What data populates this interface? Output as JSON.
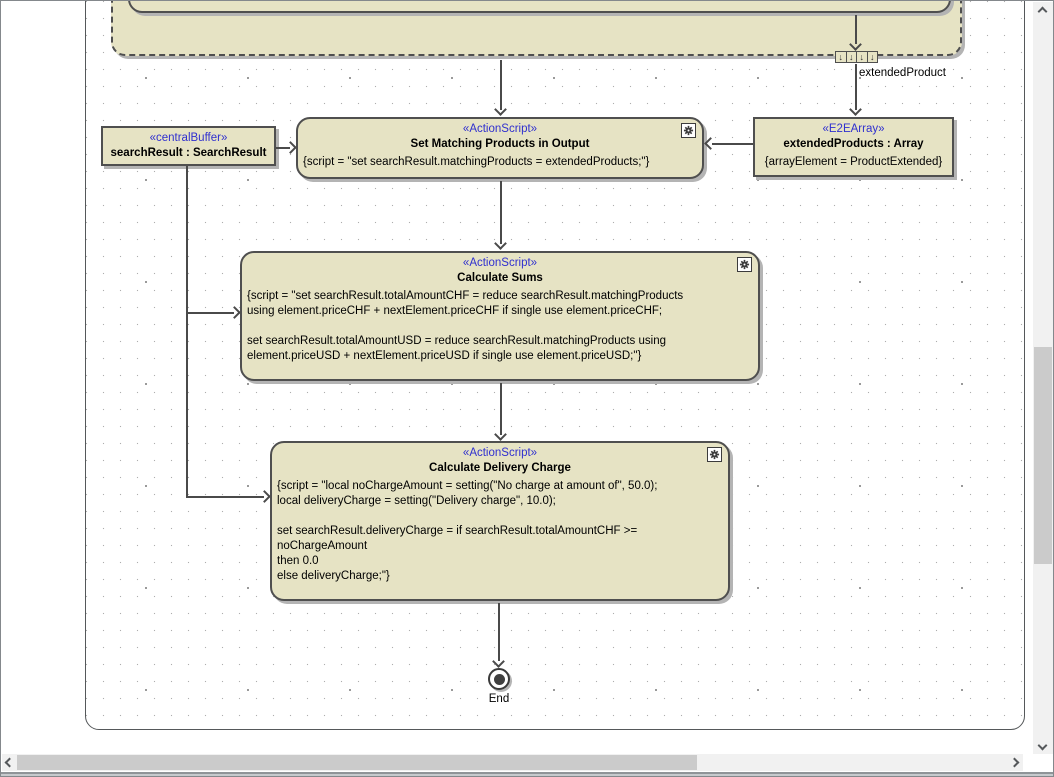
{
  "colors": {
    "node_fill": "#e6e3c4",
    "node_border": "#4f4f4f",
    "stereotype": "#3030cf",
    "edge": "#4a4a4a",
    "shadow": "#b4b4b4",
    "grid_dot": "#aeaeae",
    "grid_cross": "#9a9a9a",
    "scrollbar_track": "#f1f1f1",
    "scrollbar_thumb": "#cbcbcb",
    "scrollbar_arrow": "#55585b"
  },
  "canvas": {
    "expansion_node_label": "extendedProduct",
    "expansion_arrow_glyph": "↓",
    "end_label": "End"
  },
  "nodes": {
    "central_buffer": {
      "stereotype": "«centralBuffer»",
      "name": "searchResult : SearchResult"
    },
    "set_matching_products": {
      "stereotype": "«ActionScript»",
      "name": "Set Matching Products in Output",
      "script": "{script = \"set searchResult.matchingProducts = extendedProducts;\"}"
    },
    "extended_products": {
      "stereotype": "«E2EArray»",
      "name": "extendedProducts : Array",
      "constraint": "{arrayElement = ProductExtended}"
    },
    "calculate_sums": {
      "stereotype": "«ActionScript»",
      "name": "Calculate Sums",
      "script": "{script = \"set searchResult.totalAmountCHF = reduce searchResult.matchingProducts\nusing element.priceCHF + nextElement.priceCHF if single use element.priceCHF;\n\nset searchResult.totalAmountUSD = reduce searchResult.matchingProducts using\nelement.priceUSD + nextElement.priceUSD if single use element.priceUSD;\"}"
    },
    "calculate_delivery_charge": {
      "stereotype": "«ActionScript»",
      "name": "Calculate Delivery Charge",
      "script": "{script = \"local noChargeAmount = setting(\"No charge at amount of\", 50.0);\nlocal deliveryCharge = setting(\"Delivery charge\", 10.0);\n\nset searchResult.deliveryCharge = if searchResult.totalAmountCHF >=\nnoChargeAmount\nthen 0.0\nelse deliveryCharge;\"}"
    }
  }
}
